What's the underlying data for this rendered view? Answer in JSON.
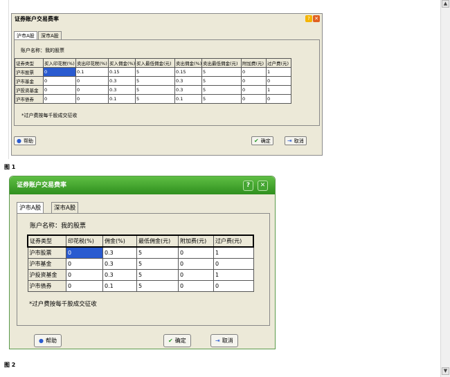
{
  "figure1": {
    "caption": "图 1",
    "dialog": {
      "title": "证券账户交易费率",
      "tabs": [
        "沪市A股",
        "深市A股"
      ],
      "account_label": "账户名称：我的股票",
      "table": {
        "headers": [
          "证券类型",
          "买入印花税(%)",
          "卖出印花税(%)",
          "买入佣金(%)",
          "买入最低佣金(元)",
          "卖出佣金(%)",
          "卖出最低佣金(元)",
          "附加费(元)",
          "过户费(元)"
        ],
        "rows": [
          [
            "沪市股票",
            "0",
            "0.1",
            "0.15",
            "5",
            "0.15",
            "5",
            "0",
            "1"
          ],
          [
            "沪市基金",
            "0",
            "0",
            "0.3",
            "5",
            "0.3",
            "5",
            "0",
            "0"
          ],
          [
            "沪投资基金",
            "0",
            "0",
            "0.3",
            "5",
            "0.3",
            "5",
            "0",
            "1"
          ],
          [
            "沪市债券",
            "0",
            "0",
            "0.1",
            "5",
            "0.1",
            "5",
            "0",
            "0"
          ]
        ]
      },
      "note": "*过户费按每千股成交征收",
      "help_label": "帮助",
      "ok_label": "确定",
      "cancel_label": "取消"
    }
  },
  "figure2": {
    "caption": "图 2",
    "dialog": {
      "title": "证券账户交易费率",
      "tabs": [
        "沪市A股",
        "深市A股"
      ],
      "account_label": "账户名称：我的股票",
      "table": {
        "headers": [
          "证券类型",
          "印花税(%)",
          "佣金(%)",
          "最低佣金(元)",
          "附加费(元)",
          "过户费(元)"
        ],
        "rows": [
          [
            "沪市股票",
            "0",
            "0.3",
            "5",
            "0",
            "1"
          ],
          [
            "沪市基金",
            "0",
            "0.3",
            "5",
            "0",
            "0"
          ],
          [
            "沪投资基金",
            "0",
            "0.3",
            "5",
            "0",
            "1"
          ],
          [
            "沪市债券",
            "0",
            "0.1",
            "5",
            "0",
            "0"
          ]
        ]
      },
      "note": "*过户费按每千股成交征收",
      "help_label": "帮助",
      "ok_label": "确定",
      "cancel_label": "取消"
    }
  },
  "icons": {
    "help": "?",
    "close": "✕",
    "info": "●",
    "ok": "✔",
    "cancel": "⇥"
  }
}
